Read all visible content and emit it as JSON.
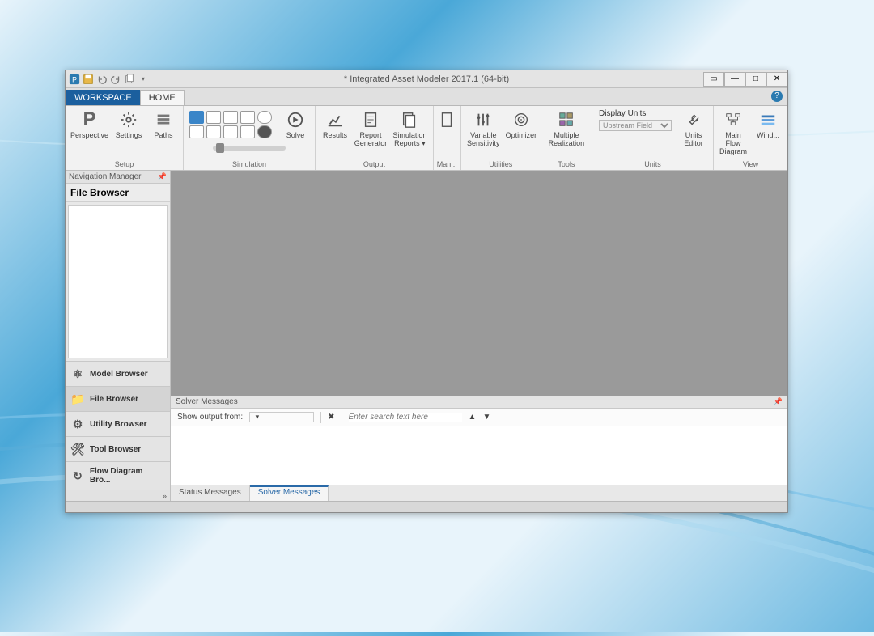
{
  "window": {
    "title": "* Integrated Asset Modeler 2017.1 (64-bit)"
  },
  "qat": {
    "dropdown_char": "▾"
  },
  "tabs": {
    "workspace": "WORKSPACE",
    "home": "HOME"
  },
  "ribbon": {
    "groups": {
      "setup": "Setup",
      "simulation": "Simulation",
      "output": "Output",
      "man": "Man...",
      "utilities": "Utilities",
      "tools": "Tools",
      "units": "Units",
      "view": "View"
    },
    "perspective": "Perspective",
    "settings": "Settings",
    "paths": "Paths",
    "solve": "Solve",
    "results": "Results",
    "report_gen": "Report Generator",
    "sim_reports": "Simulation Reports ▾",
    "variable_sens": "Variable Sensitivity",
    "optimizer": "Optimizer",
    "multi_real": "Multiple Realization",
    "display_units": "Display Units",
    "units_dropdown_placeholder": "Upstream Field",
    "units_editor": "Units Editor",
    "main_flow": "Main Flow Diagram",
    "wind": "Wind..."
  },
  "nav": {
    "header": "Navigation Manager",
    "title": "File Browser",
    "items": {
      "model": "Model Browser",
      "file": "File Browser",
      "utility": "Utility Browser",
      "tool": "Tool Browser",
      "flow": "Flow Diagram Bro..."
    }
  },
  "solver": {
    "panel_title": "Solver Messages",
    "show_output": "Show output from:",
    "search_placeholder": "Enter search text here"
  },
  "footer_tabs": {
    "status": "Status Messages",
    "solver": "Solver Messages"
  }
}
